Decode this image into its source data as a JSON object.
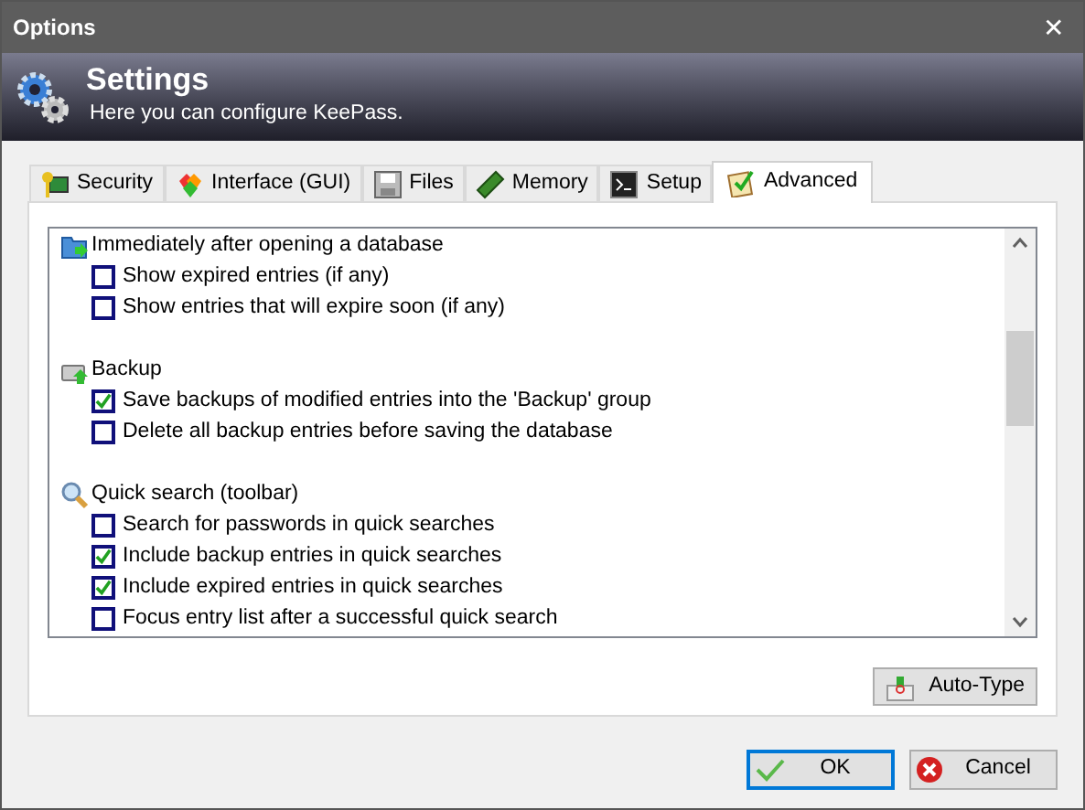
{
  "window": {
    "title": "Options",
    "close": "✕"
  },
  "header": {
    "title": "Settings",
    "subtitle": "Here you can configure KeePass."
  },
  "tabs": [
    {
      "label": "Security",
      "selected": false
    },
    {
      "label": "Interface (GUI)",
      "selected": false
    },
    {
      "label": "Files",
      "selected": false
    },
    {
      "label": "Memory",
      "selected": false
    },
    {
      "label": "Setup",
      "selected": false
    },
    {
      "label": "Advanced",
      "selected": true
    }
  ],
  "groups": [
    {
      "kind": "open",
      "label": "Immediately after opening a database",
      "items": [
        {
          "label": "Show expired entries (if any)",
          "checked": false
        },
        {
          "label": "Show entries that will expire soon (if any)",
          "checked": false
        }
      ]
    },
    {
      "kind": "backup",
      "label": "Backup",
      "items": [
        {
          "label": "Save backups of modified entries into the 'Backup' group",
          "checked": true
        },
        {
          "label": "Delete all backup entries before saving the database",
          "checked": false
        }
      ]
    },
    {
      "kind": "search",
      "label": "Quick search (toolbar)",
      "items": [
        {
          "label": "Search for passwords in quick searches",
          "checked": false
        },
        {
          "label": "Include backup entries in quick searches",
          "checked": true
        },
        {
          "label": "Include expired entries in quick searches",
          "checked": true
        },
        {
          "label": "Focus entry list after a successful quick search",
          "checked": false
        }
      ]
    }
  ],
  "auto_type_button": "Auto-Type",
  "buttons": [
    {
      "kind": "ok",
      "label": "OK"
    },
    {
      "kind": "cancel",
      "label": "Cancel"
    }
  ]
}
